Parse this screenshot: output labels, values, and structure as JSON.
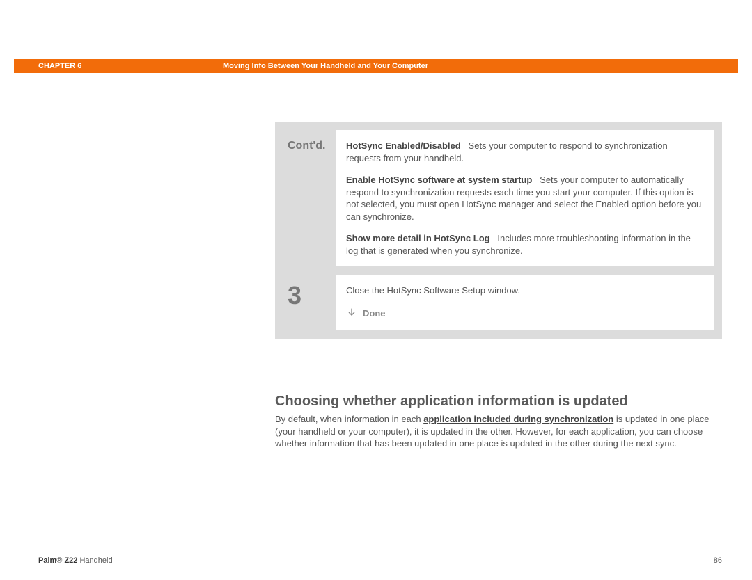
{
  "header": {
    "chapter": "CHAPTER 6",
    "title": "Moving Info Between Your Handheld and Your Computer"
  },
  "box": {
    "contd_label": "Cont'd.",
    "p1_bold": "HotSync Enabled/Disabled",
    "p1_rest": "Sets your computer to respond to synchronization requests from your handheld.",
    "p2_bold": "Enable HotSync software at system startup",
    "p2_rest": "Sets your computer to automatically respond to synchronization requests each time you start your computer. If this option is not selected, you must open HotSync manager and select the Enabled option before you can synchronize.",
    "p3_bold": "Show more detail in HotSync Log",
    "p3_rest": "Includes more troubleshooting information in the log that is generated when you synchronize.",
    "step3_label": "3",
    "step3_text": "Close the HotSync Software Setup window.",
    "done_label": "Done"
  },
  "section": {
    "heading": "Choosing whether application information is updated",
    "para_before": "By default, when information in each ",
    "para_link": "application included during synchronization",
    "para_after": " is updated in one place (your handheld or your computer), it is updated in the other. However, for each application, you can choose whether information that has been updated in one place is updated in the other during the next sync."
  },
  "footer": {
    "product_brand": "Palm",
    "product_reg": "®",
    "product_model": " Z22",
    "product_rest": " Handheld",
    "page": "86"
  }
}
